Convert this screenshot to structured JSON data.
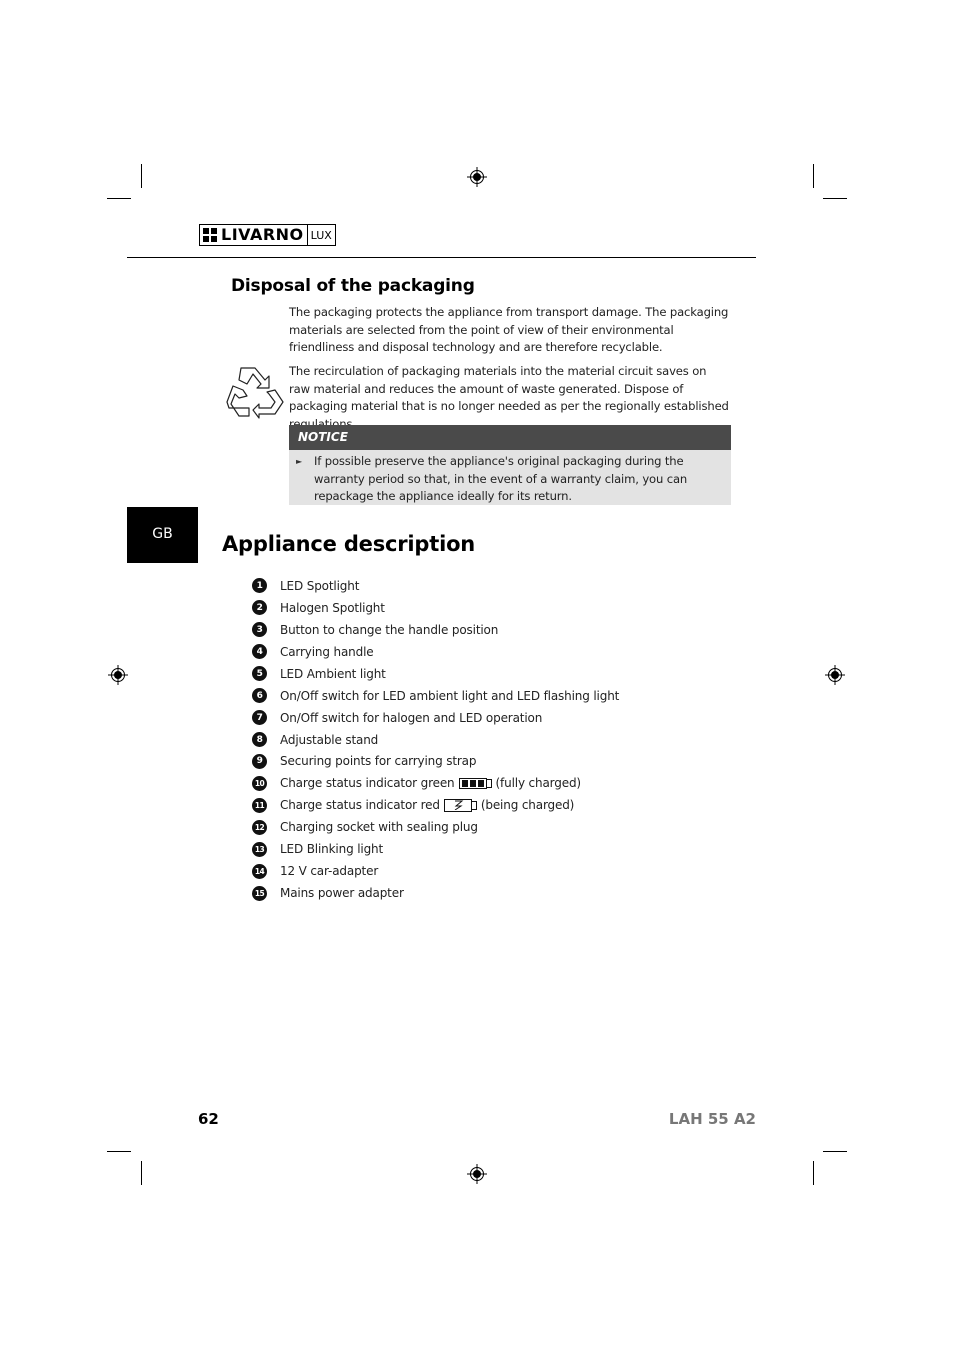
{
  "header": {
    "brand": "LIVARNO",
    "sub_brand": "LUX"
  },
  "disposal": {
    "title": "Disposal of the packaging",
    "para1": "The packaging protects the appliance from transport damage. The packaging materials are selected from the point of view of their environmental friendliness and disposal technology and are therefore recyclable.",
    "para2": "The recirculation of packaging materials into the material circuit saves on raw material and reduces the amount of waste generated. Dispose of packaging material that is no longer needed as per the regionally established regulations.",
    "icon": "recycle-icon"
  },
  "notice": {
    "heading": "NOTICE",
    "bullet_icon": "arrow-right-icon",
    "text": "If possible preserve the appliance's original packaging during the warranty period so that, in the event of a warranty claim, you can repackage the appliance ideally for its return."
  },
  "language_tab": "GB",
  "appliance": {
    "title": "Appliance description",
    "items": [
      {
        "num": "1",
        "label": "LED Spotlight"
      },
      {
        "num": "2",
        "label": "Halogen Spotlight"
      },
      {
        "num": "3",
        "label": "Button to change the handle position"
      },
      {
        "num": "4",
        "label": "Carrying handle"
      },
      {
        "num": "5",
        "label": "LED Ambient light"
      },
      {
        "num": "6",
        "label": "On/Off switch for LED ambient light and LED flashing light"
      },
      {
        "num": "7",
        "label": "On/Off switch for halogen and LED operation"
      },
      {
        "num": "8",
        "label": "Adjustable stand"
      },
      {
        "num": "9",
        "label": "Securing points for carrying strap"
      },
      {
        "num": "10",
        "label": "Charge status indicator green",
        "icon": "battery-full-icon",
        "suffix": "(fully charged)"
      },
      {
        "num": "11",
        "label": "Charge status indicator red",
        "icon": "battery-charging-icon",
        "suffix": "(being charged)"
      },
      {
        "num": "12",
        "label": "Charging socket with sealing plug"
      },
      {
        "num": "13",
        "label": "LED Blinking light"
      },
      {
        "num": "14",
        "label": "12 V car-adapter"
      },
      {
        "num": "15",
        "label": "Mains power adapter"
      }
    ]
  },
  "footer": {
    "page_number": "62",
    "model": "LAH 55 A2"
  }
}
